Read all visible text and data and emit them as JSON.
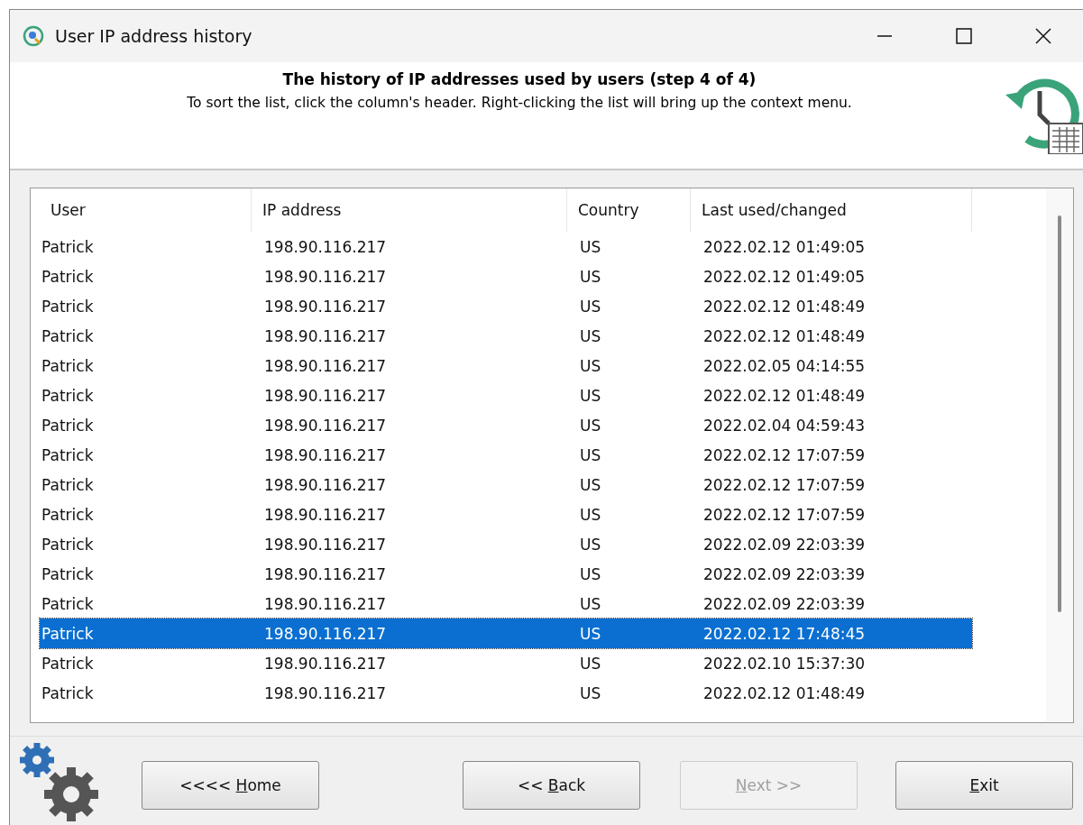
{
  "window": {
    "title": "User IP address history"
  },
  "header": {
    "title": "The history of IP addresses used by users (step 4 of 4)",
    "subtitle": "To sort the list, click the column's header. Right-clicking the list will bring up the context menu."
  },
  "table": {
    "columns": [
      "User",
      "IP address",
      "Country",
      "Last used/changed"
    ],
    "rows": [
      {
        "cells": [
          "Patrick",
          "198.90.116.217",
          "US",
          "2022.02.12 01:49:05"
        ],
        "selected": false
      },
      {
        "cells": [
          "Patrick",
          "198.90.116.217",
          "US",
          "2022.02.12 01:49:05"
        ],
        "selected": false
      },
      {
        "cells": [
          "Patrick",
          "198.90.116.217",
          "US",
          "2022.02.12 01:48:49"
        ],
        "selected": false
      },
      {
        "cells": [
          "Patrick",
          "198.90.116.217",
          "US",
          "2022.02.12 01:48:49"
        ],
        "selected": false
      },
      {
        "cells": [
          "Patrick",
          "198.90.116.217",
          "US",
          "2022.02.05 04:14:55"
        ],
        "selected": false
      },
      {
        "cells": [
          "Patrick",
          "198.90.116.217",
          "US",
          "2022.02.12 01:48:49"
        ],
        "selected": false
      },
      {
        "cells": [
          "Patrick",
          "198.90.116.217",
          "US",
          "2022.02.04 04:59:43"
        ],
        "selected": false
      },
      {
        "cells": [
          "Patrick",
          "198.90.116.217",
          "US",
          "2022.02.12 17:07:59"
        ],
        "selected": false
      },
      {
        "cells": [
          "Patrick",
          "198.90.116.217",
          "US",
          "2022.02.12 17:07:59"
        ],
        "selected": false
      },
      {
        "cells": [
          "Patrick",
          "198.90.116.217",
          "US",
          "2022.02.12 17:07:59"
        ],
        "selected": false
      },
      {
        "cells": [
          "Patrick",
          "198.90.116.217",
          "US",
          "2022.02.09 22:03:39"
        ],
        "selected": false
      },
      {
        "cells": [
          "Patrick",
          "198.90.116.217",
          "US",
          "2022.02.09 22:03:39"
        ],
        "selected": false
      },
      {
        "cells": [
          "Patrick",
          "198.90.116.217",
          "US",
          "2022.02.09 22:03:39"
        ],
        "selected": false
      },
      {
        "cells": [
          "Patrick",
          "198.90.116.217",
          "US",
          "2022.02.12 17:48:45"
        ],
        "selected": true
      },
      {
        "cells": [
          "Patrick",
          "198.90.116.217",
          "US",
          "2022.02.10 15:37:30"
        ],
        "selected": false
      },
      {
        "cells": [
          "Patrick",
          "198.90.116.217",
          "US",
          "2022.02.12 01:48:49"
        ],
        "selected": false
      }
    ]
  },
  "buttons": [
    {
      "label_start": "<<<< ",
      "accelerator": "H",
      "label_end": "ome",
      "disabled": false
    },
    {
      "label_start": "<< ",
      "accelerator": "B",
      "label_end": "ack",
      "disabled": false
    },
    {
      "accelerator": "N",
      "label_end": "ext >>",
      "disabled": true
    },
    {
      "accelerator": "E",
      "label_end": "xit",
      "disabled": false
    }
  ]
}
